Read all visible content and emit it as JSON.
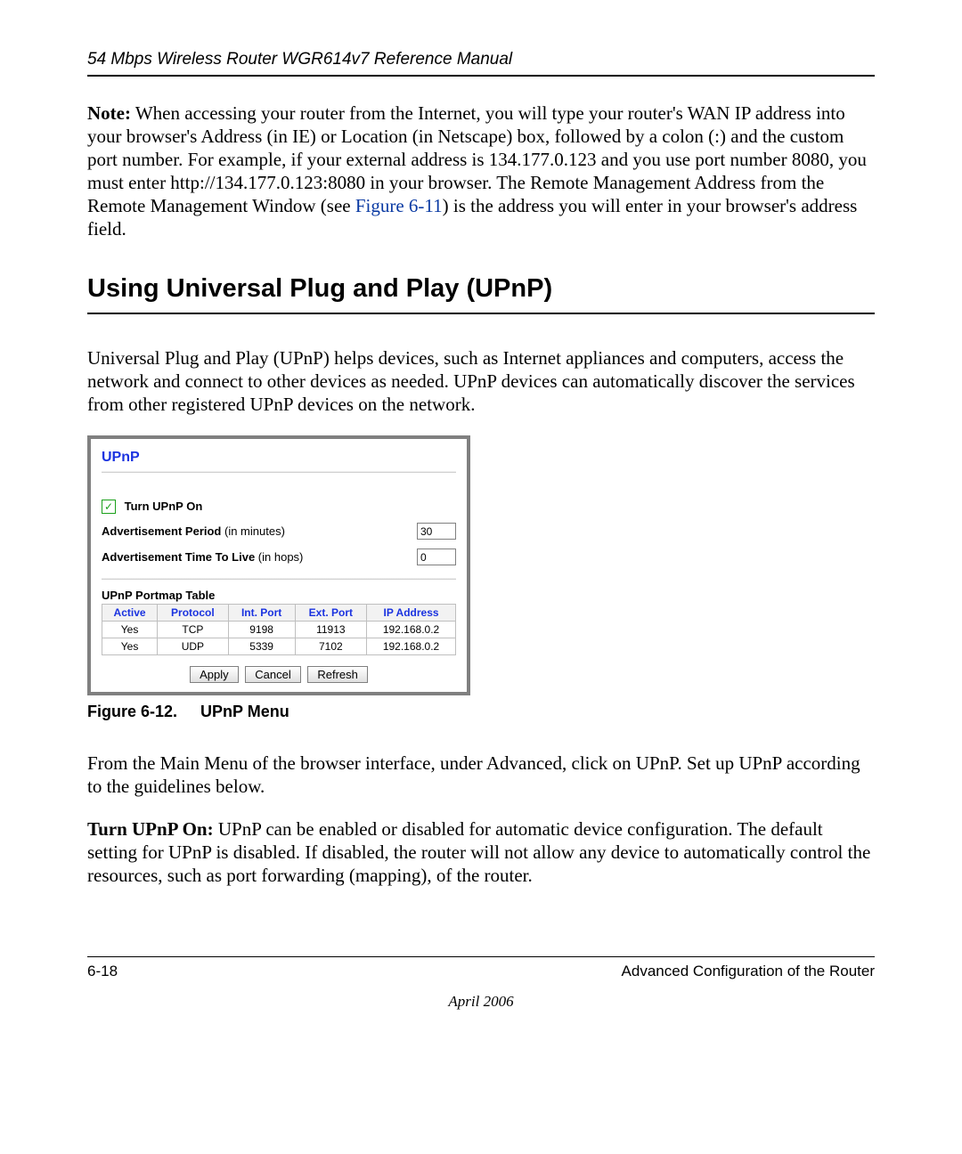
{
  "header": {
    "title": "54 Mbps Wireless Router WGR614v7 Reference Manual"
  },
  "note": {
    "label": "Note:",
    "text_before_link": " When accessing your router from the Internet, you will type your router's WAN IP address into your browser's Address (in IE) or Location (in Netscape) box, followed by a colon (:) and the custom port number. For example, if your external address is 134.177.0.123 and you use port number 8080, you must enter http://134.177.0.123:8080 in your browser. The Remote Management Address from the Remote Management Window (see ",
    "link_text": "Figure 6-11",
    "text_after_link": ") is the address you will enter in your browser's address field."
  },
  "section_heading": "Using Universal Plug and Play (UPnP)",
  "intro_para": "Universal Plug and Play (UPnP) helps devices, such as Internet appliances and computers, access the network and connect to other devices as needed. UPnP devices can automatically discover the services from other registered UPnP devices on the network.",
  "upnp_panel": {
    "title": "UPnP",
    "turn_on_label": "Turn UPnP On",
    "adv_period_label_bold": "Advertisement Period",
    "adv_period_label_rest": " (in minutes)",
    "adv_period_value": "30",
    "adv_ttl_label_bold": "Advertisement Time To Live",
    "adv_ttl_label_rest": " (in hops)",
    "adv_ttl_value": "0",
    "portmap_title": "UPnP Portmap Table",
    "columns": [
      "Active",
      "Protocol",
      "Int. Port",
      "Ext. Port",
      "IP Address"
    ],
    "rows": [
      {
        "active": "Yes",
        "protocol": "TCP",
        "int_port": "9198",
        "ext_port": "11913",
        "ip": "192.168.0.2"
      },
      {
        "active": "Yes",
        "protocol": "UDP",
        "int_port": "5339",
        "ext_port": "7102",
        "ip": "192.168.0.2"
      }
    ],
    "buttons": {
      "apply": "Apply",
      "cancel": "Cancel",
      "refresh": "Refresh"
    }
  },
  "figure_caption": {
    "num": "Figure 6-12.",
    "title": "UPnP Menu"
  },
  "para_after_figure": "From the Main Menu of the browser interface, under Advanced, click on UPnP. Set up UPnP according to the guidelines below.",
  "turn_on_para": {
    "label": "Turn UPnP On:",
    "text": " UPnP can be enabled or disabled for automatic device configuration. The default setting for UPnP is disabled. If disabled, the router will not allow any device to automatically control the resources, such as port forwarding (mapping), of the router."
  },
  "footer": {
    "page_num": "6-18",
    "section": "Advanced Configuration of the Router",
    "date": "April 2006"
  }
}
